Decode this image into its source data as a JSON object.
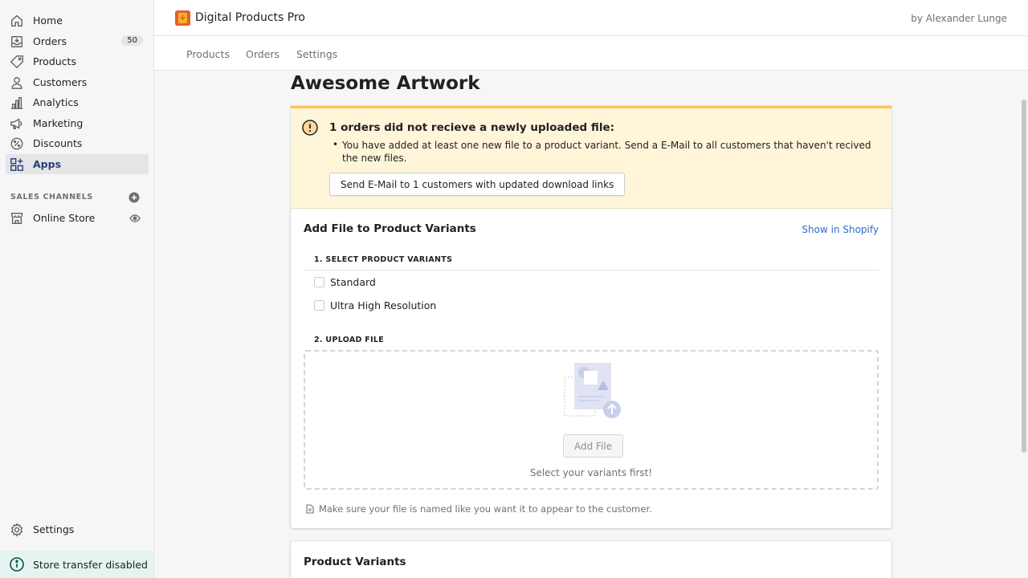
{
  "sidebar": {
    "items": [
      {
        "label": "Home",
        "icon": "home-icon"
      },
      {
        "label": "Orders",
        "icon": "orders-icon",
        "badge": "50"
      },
      {
        "label": "Products",
        "icon": "tag-icon"
      },
      {
        "label": "Customers",
        "icon": "person-icon"
      },
      {
        "label": "Analytics",
        "icon": "bar-chart-icon"
      },
      {
        "label": "Marketing",
        "icon": "megaphone-icon"
      },
      {
        "label": "Discounts",
        "icon": "discount-icon"
      },
      {
        "label": "Apps",
        "icon": "apps-icon",
        "active": true
      }
    ],
    "sales_channels_label": "SALES CHANNELS",
    "online_store": "Online Store",
    "settings": "Settings",
    "store_transfer": "Store transfer disabled"
  },
  "header": {
    "app_title": "Digital Products Pro",
    "byline": "by Alexander Lunge"
  },
  "subnav": {
    "products": "Products",
    "orders": "Orders",
    "settings": "Settings"
  },
  "page": {
    "title": "Awesome Artwork"
  },
  "banner": {
    "title": "1 orders did not recieve a newly uploaded file:",
    "text": "You have added at least one new file to a product variant. Send a E-Mail to all customers that haven't recived the new files.",
    "button": "Send E-Mail to 1 customers with updated download links"
  },
  "add_file_card": {
    "title": "Add File to Product Variants",
    "link": "Show in Shopify",
    "step1": "1. SELECT PRODUCT VARIANTS",
    "variants": [
      "Standard",
      "Ultra High Resolution"
    ],
    "step2": "2. UPLOAD FILE",
    "add_file_button": "Add File",
    "hint": "Select your variants first!",
    "note": "Make sure your file is named like you want it to appear to the customer."
  },
  "variants_card": {
    "title": "Product Variants"
  },
  "colors": {
    "accent": "#2c6ecb",
    "warning_bg": "#fff5d9",
    "warning_border": "#ffc453",
    "active_nav": "#2c3e7a"
  }
}
